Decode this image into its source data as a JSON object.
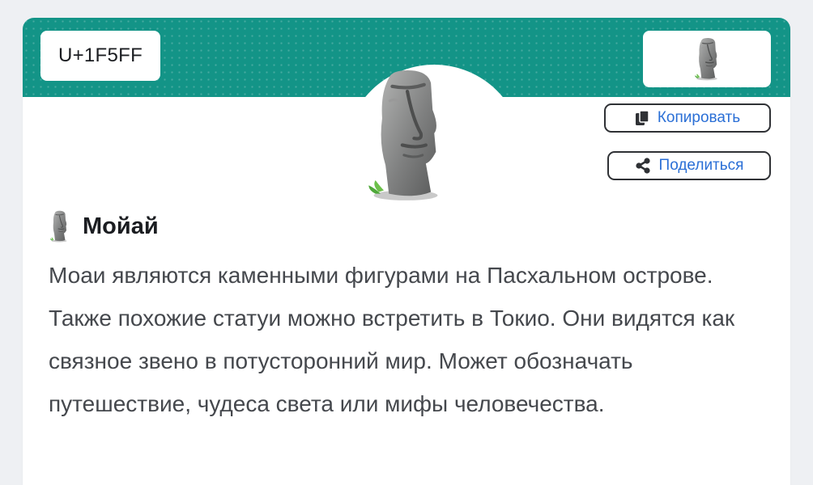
{
  "emoji": {
    "codepoint": "U+1F5FF",
    "name": "Мойай",
    "description": "Моаи являются каменными фигурами на Пасхальном острове. Также похожие статуи можно встретить в Токио. Они видятся как связное звено в потусторонний мир. Может обозначать путешествие, чудеса света или мифы человечества.",
    "icon": "moai-icon"
  },
  "actions": {
    "copy_label": "Копировать",
    "share_label": "Поделиться"
  },
  "colors": {
    "banner": "#139487",
    "link": "#2a6fd6",
    "text": "#45484d"
  }
}
